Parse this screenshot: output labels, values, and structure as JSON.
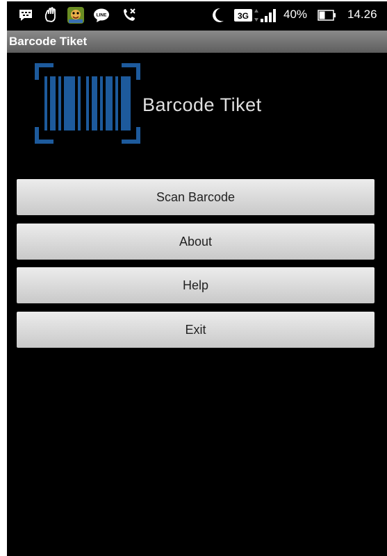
{
  "status_bar": {
    "icons": [
      "bbm-icon",
      "hand-wave-icon",
      "game-app-icon",
      "line-icon",
      "missed-call-icon",
      "moon-icon",
      "network-3g-icon",
      "signal-icon",
      "battery-icon"
    ],
    "network_type": "3G",
    "battery_percent": "40%",
    "time": "14.26"
  },
  "action_bar": {
    "title": "Barcode Tiket"
  },
  "header": {
    "logo_icon": "barcode-scan-icon",
    "app_name": "Barcode Tiket"
  },
  "menu": {
    "buttons": [
      {
        "label": "Scan Barcode"
      },
      {
        "label": "About"
      },
      {
        "label": "Help"
      },
      {
        "label": "Exit"
      }
    ]
  },
  "colors": {
    "background": "#000000",
    "action_bar": "#7a7a7a",
    "button_face": "#dcdcdc",
    "logo_blue": "#1d5a9c",
    "title_text": "#e0e0e0"
  }
}
